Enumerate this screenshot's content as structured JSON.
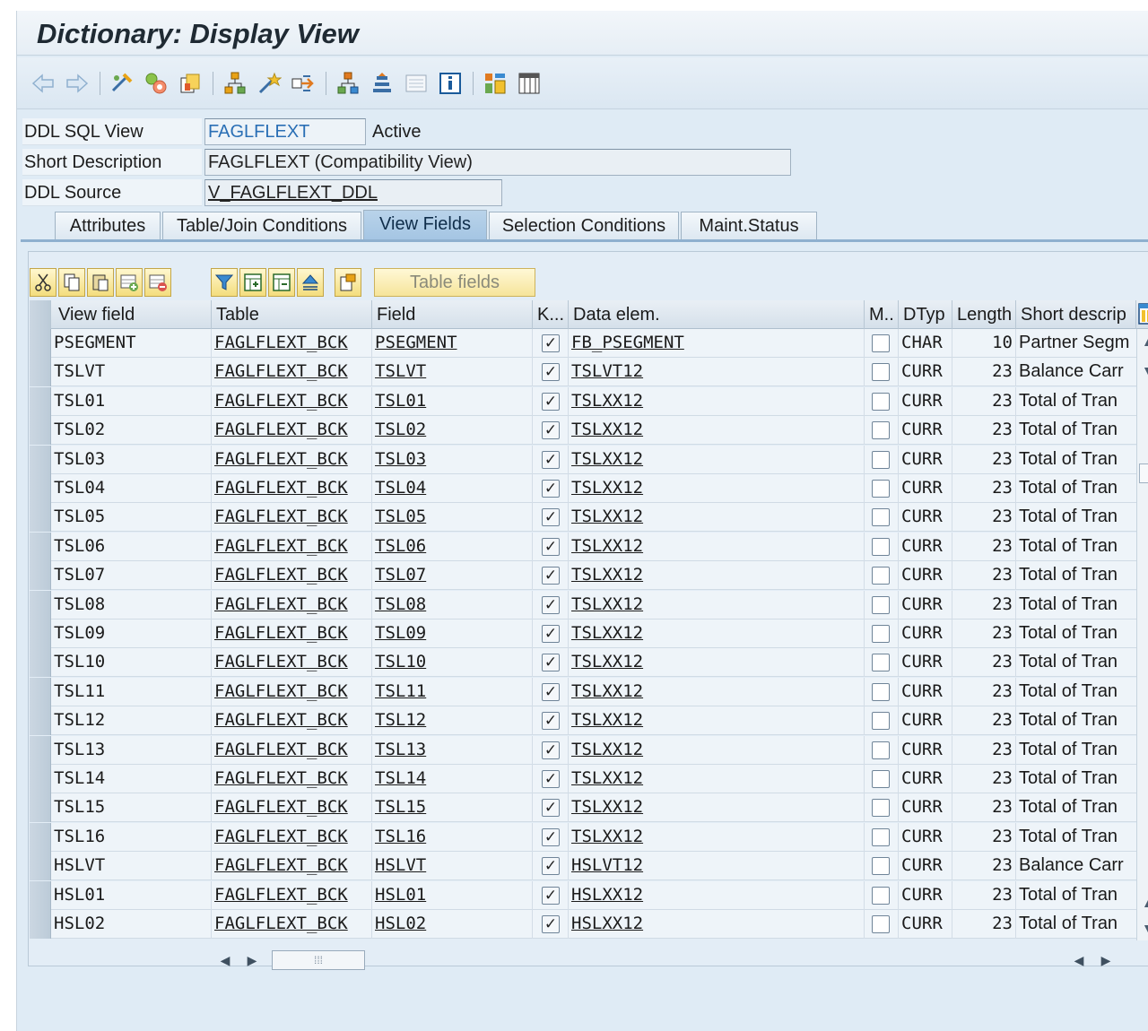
{
  "window": {
    "title": "Dictionary: Display View"
  },
  "toolbar": {
    "icons": [
      "back-icon",
      "forward-icon",
      "other-object-icon",
      "display-change-icon",
      "active-inactive-icon",
      "where-used-icon",
      "object-list-icon",
      "navigation-icon",
      "hierarchy-icon",
      "object-directory-icon",
      "technical-settings-icon",
      "documentation-icon",
      "layout-icon",
      "field-list-icon"
    ]
  },
  "form": {
    "ddl_sql_view_label": "DDL SQL View",
    "ddl_sql_view_value": "FAGLFLEXT",
    "status": "Active",
    "short_desc_label": "Short Description",
    "short_desc_value": "FAGLFLEXT (Compatibility View)",
    "ddl_source_label": "DDL Source",
    "ddl_source_value": "V_FAGLFLEXT_DDL"
  },
  "tabs": [
    {
      "label": "Attributes",
      "active": false
    },
    {
      "label": "Table/Join Conditions",
      "active": false
    },
    {
      "label": "View Fields",
      "active": true
    },
    {
      "label": "Selection Conditions",
      "active": false
    },
    {
      "label": "Maint.Status",
      "active": false
    }
  ],
  "grid_toolbar": {
    "table_fields_label": "Table fields"
  },
  "grid": {
    "columns": [
      "View field",
      "Table",
      "Field",
      "K...",
      "Data elem.",
      "M..",
      "DTyp",
      "Length",
      "Short descrip"
    ],
    "rows": [
      {
        "view_field": "PSEGMENT",
        "table": "FAGLFLEXT_BCK",
        "field": "PSEGMENT",
        "key": true,
        "data_elem": "FB_PSEGMENT",
        "mod": false,
        "dtyp": "CHAR",
        "length": "10",
        "desc": "Partner Segm"
      },
      {
        "view_field": "TSLVT",
        "table": "FAGLFLEXT_BCK",
        "field": "TSLVT",
        "key": true,
        "data_elem": "TSLVT12",
        "mod": false,
        "dtyp": "CURR",
        "length": "23",
        "desc": "Balance Carr"
      },
      {
        "view_field": "TSL01",
        "table": "FAGLFLEXT_BCK",
        "field": "TSL01",
        "key": true,
        "data_elem": "TSLXX12",
        "mod": false,
        "dtyp": "CURR",
        "length": "23",
        "desc": "Total of Tran"
      },
      {
        "view_field": "TSL02",
        "table": "FAGLFLEXT_BCK",
        "field": "TSL02",
        "key": true,
        "data_elem": "TSLXX12",
        "mod": false,
        "dtyp": "CURR",
        "length": "23",
        "desc": "Total of Tran"
      },
      {
        "view_field": "TSL03",
        "table": "FAGLFLEXT_BCK",
        "field": "TSL03",
        "key": true,
        "data_elem": "TSLXX12",
        "mod": false,
        "dtyp": "CURR",
        "length": "23",
        "desc": "Total of Tran"
      },
      {
        "view_field": "TSL04",
        "table": "FAGLFLEXT_BCK",
        "field": "TSL04",
        "key": true,
        "data_elem": "TSLXX12",
        "mod": false,
        "dtyp": "CURR",
        "length": "23",
        "desc": "Total of Tran"
      },
      {
        "view_field": "TSL05",
        "table": "FAGLFLEXT_BCK",
        "field": "TSL05",
        "key": true,
        "data_elem": "TSLXX12",
        "mod": false,
        "dtyp": "CURR",
        "length": "23",
        "desc": "Total of Tran"
      },
      {
        "view_field": "TSL06",
        "table": "FAGLFLEXT_BCK",
        "field": "TSL06",
        "key": true,
        "data_elem": "TSLXX12",
        "mod": false,
        "dtyp": "CURR",
        "length": "23",
        "desc": "Total of Tran"
      },
      {
        "view_field": "TSL07",
        "table": "FAGLFLEXT_BCK",
        "field": "TSL07",
        "key": true,
        "data_elem": "TSLXX12",
        "mod": false,
        "dtyp": "CURR",
        "length": "23",
        "desc": "Total of Tran"
      },
      {
        "view_field": "TSL08",
        "table": "FAGLFLEXT_BCK",
        "field": "TSL08",
        "key": true,
        "data_elem": "TSLXX12",
        "mod": false,
        "dtyp": "CURR",
        "length": "23",
        "desc": "Total of Tran"
      },
      {
        "view_field": "TSL09",
        "table": "FAGLFLEXT_BCK",
        "field": "TSL09",
        "key": true,
        "data_elem": "TSLXX12",
        "mod": false,
        "dtyp": "CURR",
        "length": "23",
        "desc": "Total of Tran"
      },
      {
        "view_field": "TSL10",
        "table": "FAGLFLEXT_BCK",
        "field": "TSL10",
        "key": true,
        "data_elem": "TSLXX12",
        "mod": false,
        "dtyp": "CURR",
        "length": "23",
        "desc": "Total of Tran"
      },
      {
        "view_field": "TSL11",
        "table": "FAGLFLEXT_BCK",
        "field": "TSL11",
        "key": true,
        "data_elem": "TSLXX12",
        "mod": false,
        "dtyp": "CURR",
        "length": "23",
        "desc": "Total of Tran"
      },
      {
        "view_field": "TSL12",
        "table": "FAGLFLEXT_BCK",
        "field": "TSL12",
        "key": true,
        "data_elem": "TSLXX12",
        "mod": false,
        "dtyp": "CURR",
        "length": "23",
        "desc": "Total of Tran"
      },
      {
        "view_field": "TSL13",
        "table": "FAGLFLEXT_BCK",
        "field": "TSL13",
        "key": true,
        "data_elem": "TSLXX12",
        "mod": false,
        "dtyp": "CURR",
        "length": "23",
        "desc": "Total of Tran"
      },
      {
        "view_field": "TSL14",
        "table": "FAGLFLEXT_BCK",
        "field": "TSL14",
        "key": true,
        "data_elem": "TSLXX12",
        "mod": false,
        "dtyp": "CURR",
        "length": "23",
        "desc": "Total of Tran"
      },
      {
        "view_field": "TSL15",
        "table": "FAGLFLEXT_BCK",
        "field": "TSL15",
        "key": true,
        "data_elem": "TSLXX12",
        "mod": false,
        "dtyp": "CURR",
        "length": "23",
        "desc": "Total of Tran"
      },
      {
        "view_field": "TSL16",
        "table": "FAGLFLEXT_BCK",
        "field": "TSL16",
        "key": true,
        "data_elem": "TSLXX12",
        "mod": false,
        "dtyp": "CURR",
        "length": "23",
        "desc": "Total of Tran"
      },
      {
        "view_field": "HSLVT",
        "table": "FAGLFLEXT_BCK",
        "field": "HSLVT",
        "key": true,
        "data_elem": "HSLVT12",
        "mod": false,
        "dtyp": "CURR",
        "length": "23",
        "desc": "Balance Carr"
      },
      {
        "view_field": "HSL01",
        "table": "FAGLFLEXT_BCK",
        "field": "HSL01",
        "key": true,
        "data_elem": "HSLXX12",
        "mod": false,
        "dtyp": "CURR",
        "length": "23",
        "desc": "Total of Tran"
      },
      {
        "view_field": "HSL02",
        "table": "FAGLFLEXT_BCK",
        "field": "HSL02",
        "key": true,
        "data_elem": "HSLXX12",
        "mod": false,
        "dtyp": "CURR",
        "length": "23",
        "desc": "Total of Tran"
      }
    ]
  }
}
